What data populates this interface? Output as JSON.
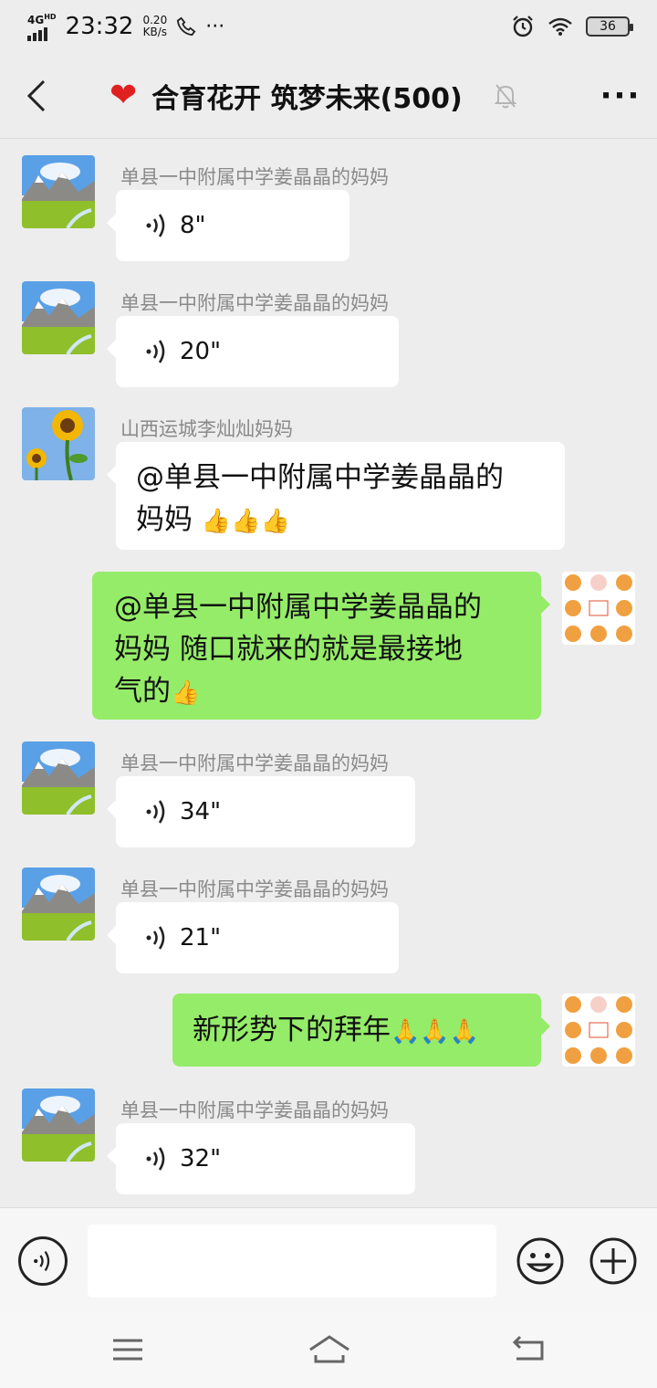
{
  "status_bar": {
    "network": "4G",
    "network_sup": "HD",
    "time": "23:32",
    "speed_value": "0.20",
    "speed_unit": "KB/s",
    "more": "···",
    "battery": "36"
  },
  "header": {
    "title": "合育花开 筑梦未来(500)"
  },
  "messages": [
    {
      "sender": "单县一中附属中学姜晶晶的妈妈",
      "type": "voice",
      "duration": "8\""
    },
    {
      "sender": "单县一中附属中学姜晶晶的妈妈",
      "type": "voice",
      "duration": "20\""
    },
    {
      "sender": "山西运城李灿灿妈妈",
      "type": "text",
      "line1": "@单县一中附属中学姜晶晶的",
      "line2": "妈妈 "
    },
    {
      "type": "text",
      "self": true,
      "line1": "@单县一中附属中学姜晶晶的",
      "line2": "妈妈  随口就来的就是最接地",
      "line3": "气的"
    },
    {
      "sender": "单县一中附属中学姜晶晶的妈妈",
      "type": "voice",
      "duration": "34\""
    },
    {
      "sender": "单县一中附属中学姜晶晶的妈妈",
      "type": "voice",
      "duration": "21\""
    },
    {
      "type": "text",
      "self": true,
      "line1": "新形势下的拜年"
    },
    {
      "sender": "单县一中附属中学姜晶晶的妈妈",
      "type": "voice",
      "duration": "32\""
    }
  ],
  "input": {
    "placeholder": ""
  },
  "colors": {
    "self_bubble": "#95ec69",
    "other_bubble": "#ffffff",
    "background": "#ededed"
  },
  "icons": [
    "back-icon",
    "heart-icon",
    "mute-icon",
    "more-icon",
    "voice-wave-icon",
    "thumbs-up-icon",
    "pray-icon",
    "smiley-icon",
    "plus-icon",
    "menu-icon",
    "home-icon",
    "return-icon"
  ]
}
